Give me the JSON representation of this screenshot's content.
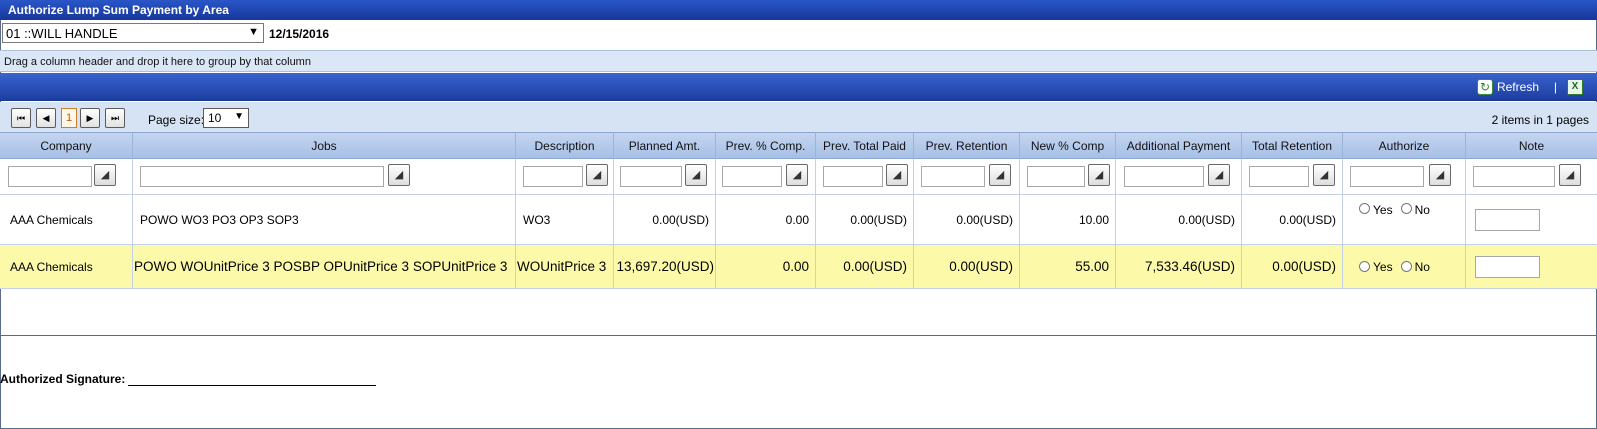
{
  "window": {
    "title": "Authorize Lump Sum Payment by Area"
  },
  "filter": {
    "area_value": "01 ::WILL HANDLE",
    "date": "12/15/2016"
  },
  "group_hint": "Drag a column header and drop it here to group by that column",
  "toolbar": {
    "refresh_label": "Refresh",
    "separator": "|"
  },
  "pager": {
    "current_page": "1",
    "page_size_label": "Page size:",
    "page_size_value": "10",
    "items_info": "2 items in 1 pages"
  },
  "columns": [
    "Company",
    "Jobs",
    "Description",
    "Planned Amt.",
    "Prev. % Comp.",
    "Prev. Total Paid",
    "Prev. Retention",
    "New % Comp",
    "Additional Payment",
    "Total Retention",
    "Authorize",
    "Note"
  ],
  "rows": [
    {
      "company": "AAA Chemicals",
      "jobs": "POWO WO3 PO3 OP3 SOP3",
      "description": "WO3",
      "planned_amt": "0.00(USD)",
      "prev_pct_comp": "0.00",
      "prev_total_paid": "0.00(USD)",
      "prev_retention": "0.00(USD)",
      "new_pct_comp": "10.00",
      "additional_payment": "0.00(USD)",
      "total_retention": "0.00(USD)",
      "yes_label": "Yes",
      "no_label": "No"
    },
    {
      "company": "AAA Chemicals",
      "jobs": "POWO WOUnitPrice 3 POSBP OPUnitPrice 3 SOPUnitPrice 3",
      "description": "WOUnitPrice 3",
      "planned_amt": "13,697.20(USD)",
      "prev_pct_comp": "0.00",
      "prev_total_paid": "0.00(USD)",
      "prev_retention": "0.00(USD)",
      "new_pct_comp": "55.00",
      "additional_payment": "7,533.46(USD)",
      "total_retention": "0.00(USD)",
      "yes_label": "Yes",
      "no_label": "No"
    }
  ],
  "signature": {
    "label": "Authorized Signature:"
  },
  "colors": {
    "title_bar": "#1f45b8",
    "header_bg": "#b5c9ea",
    "highlight_row": "#fcfaa9"
  }
}
